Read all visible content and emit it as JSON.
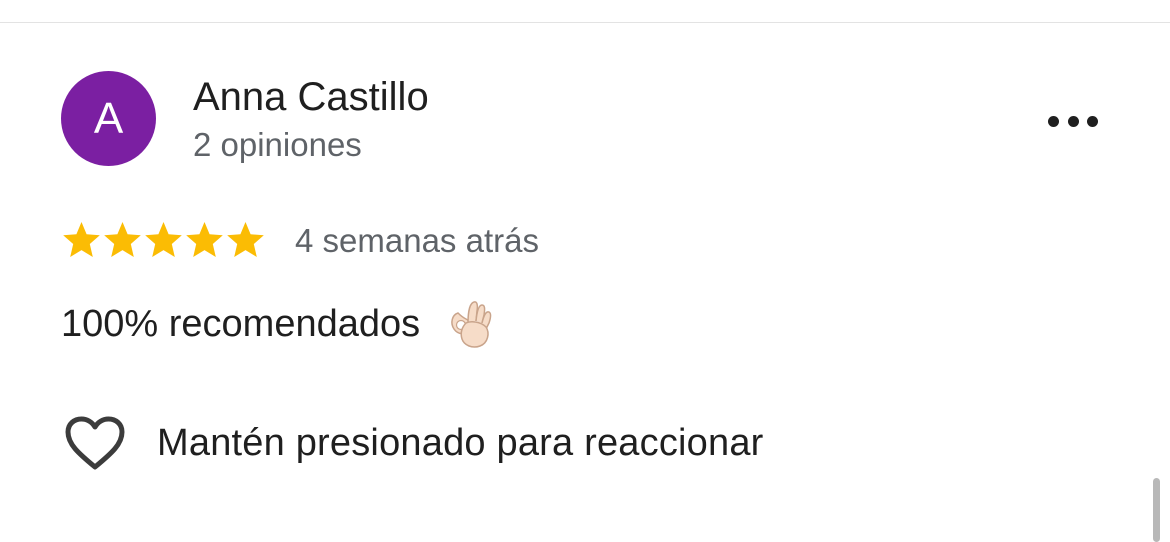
{
  "review": {
    "author": {
      "initial": "A",
      "name": "Anna Castillo",
      "reviews_count": "2 opiniones",
      "avatar_color": "#7b1fa2"
    },
    "rating": 5,
    "rating_max": 5,
    "star_color": "#fbbc04",
    "date": "4 semanas atrás",
    "text": "100% recomendados",
    "text_emoji": "ok-hand-emoji"
  },
  "actions": {
    "more_icon": "more-horizontal-icon",
    "react_icon": "heart-outline-icon",
    "react_label": "Mantén presionado para reaccionar"
  }
}
